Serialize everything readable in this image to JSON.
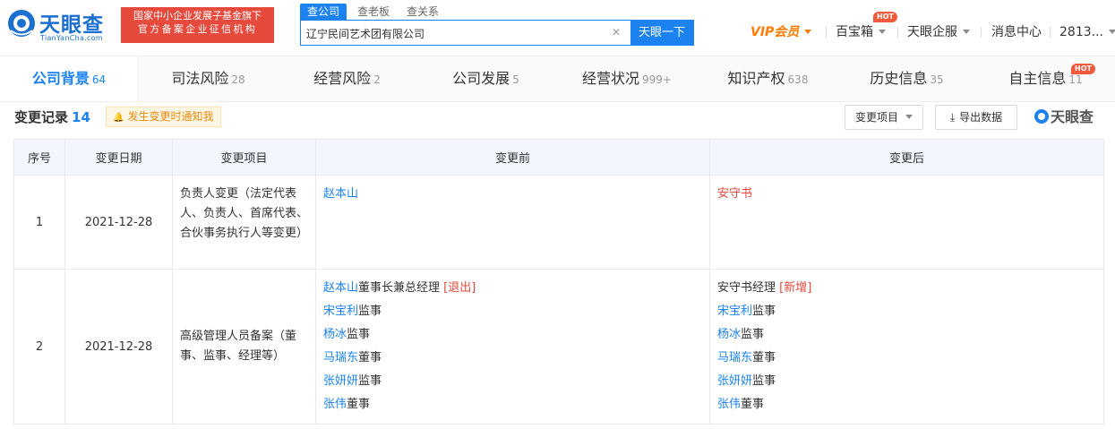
{
  "header": {
    "logo_name": "天眼查",
    "logo_domain": "TianYanCha.com",
    "badge_line1": "国家中小企业发展子基金旗下",
    "badge_line2": "官方备案企业征信机构",
    "search_tabs": [
      "查公司",
      "查老板",
      "查关系"
    ],
    "search_value": "辽宁民间艺术团有限公司",
    "search_button": "天眼一下",
    "nav": {
      "vip": "VIP会员",
      "baobaoxiang": "百宝箱",
      "enterprise": "天眼企服",
      "messages": "消息中心",
      "user": "2813..."
    },
    "hot_label": "HOT"
  },
  "tabs": [
    {
      "label": "公司背景",
      "count": "64"
    },
    {
      "label": "司法风险",
      "count": "28"
    },
    {
      "label": "经营风险",
      "count": "2"
    },
    {
      "label": "公司发展",
      "count": "5"
    },
    {
      "label": "经营状况",
      "count": "999+"
    },
    {
      "label": "知识产权",
      "count": "638"
    },
    {
      "label": "历史信息",
      "count": "35"
    },
    {
      "label": "自主信息",
      "count": "11"
    }
  ],
  "section": {
    "title": "变更记录",
    "count": "14",
    "notify": "发生变更时通知我",
    "filter_button": "变更项目",
    "export_button": "导出数据",
    "watermark": "天眼查"
  },
  "table": {
    "headers": [
      "序号",
      "变更日期",
      "变更项目",
      "变更前",
      "变更后"
    ],
    "rows": [
      {
        "index": "1",
        "date": "2021-12-28",
        "item": "负责人变更（法定代表人、负责人、首席代表、合伙事务执行人等变更）",
        "before": [
          {
            "name": "赵本山"
          }
        ],
        "after": [
          {
            "name": "安守书"
          }
        ]
      },
      {
        "index": "2",
        "date": "2021-12-28",
        "item": "高级管理人员备案（董事、监事、经理等）",
        "before": [
          {
            "name": "赵本山",
            "role": "董事长兼总经理",
            "tag": "[退出]"
          },
          {
            "name": "宋宝利",
            "role": "监事"
          },
          {
            "name": "杨冰",
            "role": "监事"
          },
          {
            "name": "马瑞东",
            "role": "董事"
          },
          {
            "name": "张妍妍",
            "role": "监事"
          },
          {
            "name": "张伟",
            "role": "董事"
          }
        ],
        "after": [
          {
            "name": "安守书",
            "role": "经理",
            "tag": "[新增]"
          },
          {
            "name": "宋宝利",
            "role": "监事"
          },
          {
            "name": "杨冰",
            "role": "监事"
          },
          {
            "name": "马瑞东",
            "role": "董事"
          },
          {
            "name": "张妍妍",
            "role": "监事"
          },
          {
            "name": "张伟",
            "role": "董事"
          }
        ]
      }
    ]
  },
  "colors": {
    "brand_blue": "#1b82ef",
    "badge_red": "#e64a3c",
    "vip_orange": "#ff7b00",
    "hot_red": "#f25a3c"
  }
}
